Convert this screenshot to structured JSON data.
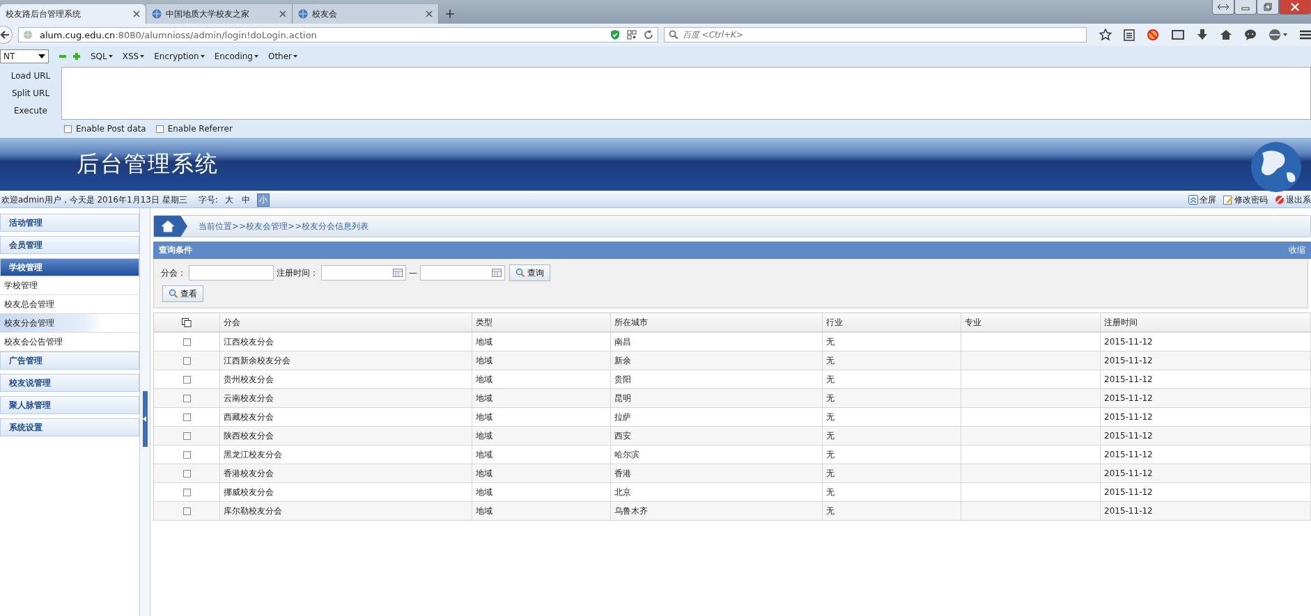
{
  "browser": {
    "tabs": [
      {
        "title": "校友路后台管理系统",
        "selected": true,
        "has_icon": false
      },
      {
        "title": "中国地质大学校友之家",
        "selected": false,
        "has_icon": true
      },
      {
        "title": "校友会",
        "selected": false,
        "has_icon": true
      }
    ],
    "url_host": "alum.cug.edu.cn",
    "url_rest": ":8080/alumnioss/admin/login!doLogin.action",
    "search_placeholder": "百度 <Ctrl+K>"
  },
  "hackbar": {
    "select_value": "NT",
    "menus": [
      "SQL",
      "XSS",
      "Encryption",
      "Encoding",
      "Other"
    ],
    "actions": [
      "Load URL",
      "Split URL",
      "Execute"
    ],
    "options": [
      {
        "label": "Enable Post data",
        "checked": false
      },
      {
        "label": "Enable Referrer",
        "checked": false
      }
    ]
  },
  "banner": {
    "title": "后台管理系统"
  },
  "topbar": {
    "welcome": "欢迎admin用户，今天是 2016年1月13日 星期三",
    "font_label": "字号:",
    "font_sizes": [
      {
        "label": "大",
        "selected": false
      },
      {
        "label": "中",
        "selected": false
      },
      {
        "label": "小",
        "selected": true
      }
    ],
    "links": [
      {
        "kind": "fullscreen",
        "label": "全屏"
      },
      {
        "kind": "password",
        "label": "修改密码"
      },
      {
        "kind": "logout",
        "label": "退出系"
      }
    ]
  },
  "sidebar": {
    "groups": [
      {
        "label": "活动管理",
        "expanded": false
      },
      {
        "label": "会员管理",
        "expanded": false
      },
      {
        "label": "学校管理",
        "expanded": true,
        "children": [
          {
            "label": "学校管理",
            "selected": false
          },
          {
            "label": "校友总会管理",
            "selected": false
          },
          {
            "label": "校友分会管理",
            "selected": true
          },
          {
            "label": "校友会公告管理",
            "selected": false
          }
        ]
      },
      {
        "label": "广告管理",
        "expanded": false
      },
      {
        "label": "校友说管理",
        "expanded": false
      },
      {
        "label": "聚人脉管理",
        "expanded": false
      },
      {
        "label": "系统设置",
        "expanded": false
      }
    ]
  },
  "breadcrumb": "当前位置>>校友会管理>>校友分会信息列表",
  "query": {
    "title": "查询条件",
    "collapse": "收缩",
    "branch_label": "分会：",
    "date_label": "注册时间：",
    "date_separator": "—",
    "search_button": "查询",
    "view_button": "查看"
  },
  "table": {
    "columns": [
      "分会",
      "类型",
      "所在城市",
      "行业",
      "专业",
      "注册时间"
    ],
    "rows": [
      {
        "checked": false,
        "cells": [
          "江西校友分会",
          "地域",
          "南昌",
          "无",
          "",
          "2015-11-12"
        ]
      },
      {
        "checked": false,
        "cells": [
          "江西新余校友分会",
          "地域",
          "新余",
          "无",
          "",
          "2015-11-12"
        ]
      },
      {
        "checked": false,
        "cells": [
          "贵州校友分会",
          "地域",
          "贵阳",
          "无",
          "",
          "2015-11-12"
        ]
      },
      {
        "checked": false,
        "cells": [
          "云南校友分会",
          "地域",
          "昆明",
          "无",
          "",
          "2015-11-12"
        ]
      },
      {
        "checked": false,
        "cells": [
          "西藏校友分会",
          "地域",
          "拉萨",
          "无",
          "",
          "2015-11-12"
        ]
      },
      {
        "checked": false,
        "cells": [
          "陕西校友分会",
          "地域",
          "西安",
          "无",
          "",
          "2015-11-12"
        ]
      },
      {
        "checked": false,
        "cells": [
          "黑龙江校友分会",
          "地域",
          "哈尔滨",
          "无",
          "",
          "2015-11-12"
        ]
      },
      {
        "checked": false,
        "cells": [
          "香港校友分会",
          "地域",
          "香港",
          "无",
          "",
          "2015-11-12"
        ]
      },
      {
        "checked": false,
        "cells": [
          "挪威校友分会",
          "地域",
          "北京",
          "无",
          "",
          "2015-11-12"
        ]
      },
      {
        "checked": false,
        "cells": [
          "库尔勒校友分会",
          "地域",
          "乌鲁木齐",
          "无",
          "",
          "2015-11-12"
        ]
      }
    ]
  }
}
